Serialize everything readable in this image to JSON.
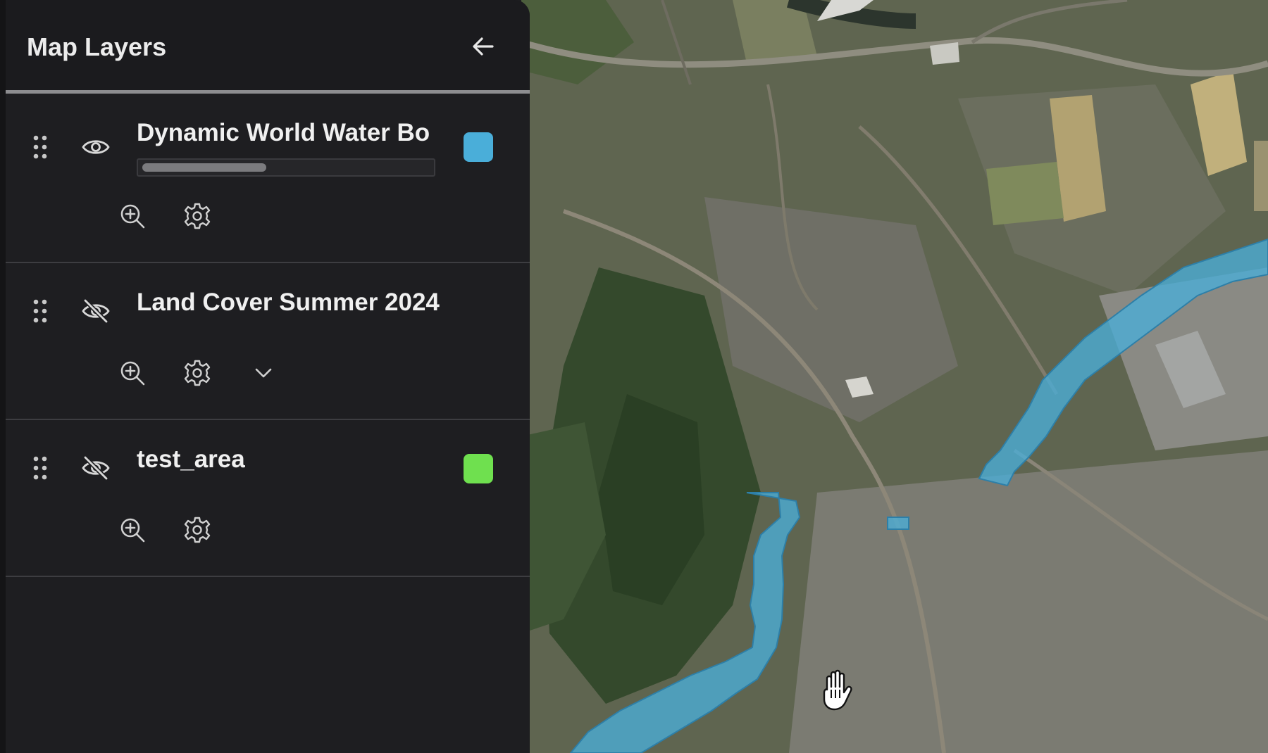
{
  "panel": {
    "title": "Map Layers",
    "back_icon": "arrow-left-icon"
  },
  "layers": [
    {
      "name": "Dynamic World Water Bo",
      "visible": true,
      "color": "#4aaed9",
      "opacity": 0.42,
      "icons": [
        "drag-handle-icon",
        "eye-icon",
        "zoom-in-icon",
        "gear-icon"
      ]
    },
    {
      "name": "Land Cover Summer 2024",
      "visible": false,
      "icons": [
        "drag-handle-icon",
        "eye-off-icon",
        "zoom-in-icon",
        "gear-icon",
        "chevron-down-icon"
      ]
    },
    {
      "name": "test_area",
      "visible": false,
      "color": "#6fe04f",
      "icons": [
        "drag-handle-icon",
        "eye-off-icon",
        "zoom-in-icon",
        "gear-icon"
      ]
    }
  ],
  "map": {
    "basemap": "satellite imagery",
    "water_overlay_color": "#4aaed9",
    "cursor": "grab-hand-icon"
  }
}
